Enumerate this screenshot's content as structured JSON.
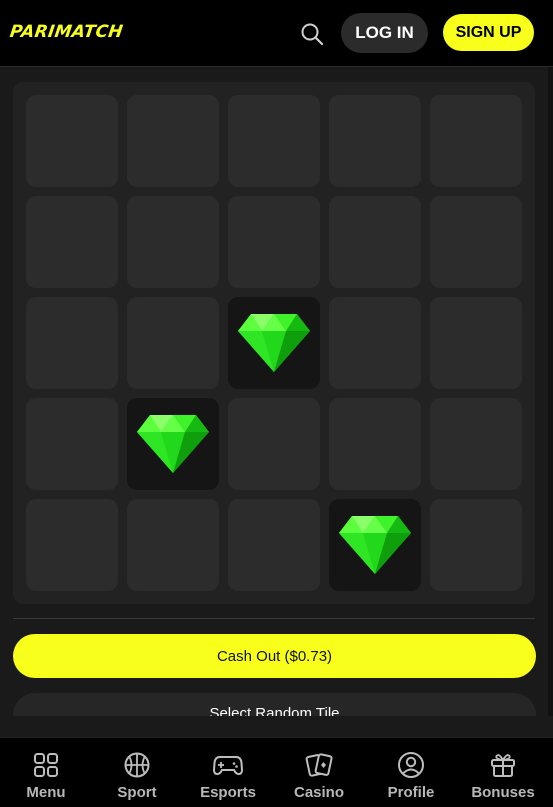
{
  "header": {
    "logo_text": "PARIMATCH",
    "login_label": "LOG IN",
    "signup_label": "SIGN UP",
    "search_icon": "search-icon"
  },
  "colors": {
    "brand_yellow": "#f7ff1a",
    "gem_green": "#22e81c",
    "tile_hidden": "#2c2c2c",
    "tile_revealed": "#151515"
  },
  "board": {
    "rows": 5,
    "cols": 5,
    "revealed_gems": [
      [
        2,
        2
      ],
      [
        3,
        1
      ],
      [
        4,
        3
      ]
    ]
  },
  "actions": {
    "cashout_label": "Cash Out ($0.73)",
    "random_label": "Select Random Tile"
  },
  "bottom_nav": [
    {
      "label": "Menu",
      "icon": "grid-icon"
    },
    {
      "label": "Sport",
      "icon": "basketball-icon"
    },
    {
      "label": "Esports",
      "icon": "gamepad-icon"
    },
    {
      "label": "Casino",
      "icon": "cards-icon"
    },
    {
      "label": "Profile",
      "icon": "user-icon"
    },
    {
      "label": "Bonuses",
      "icon": "gift-icon"
    }
  ]
}
